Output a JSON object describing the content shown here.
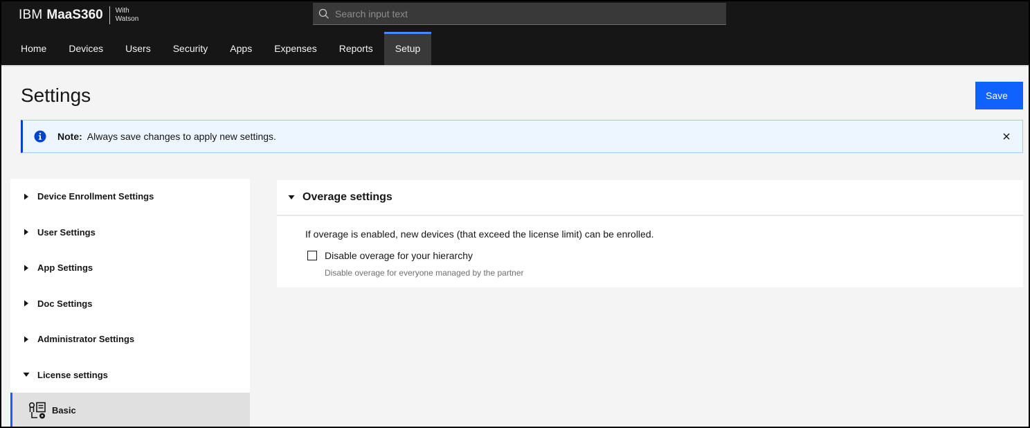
{
  "header": {
    "brand_company": "IBM",
    "brand_product": "MaaS360",
    "brand_with": "With Watson",
    "search_placeholder": "Search input text",
    "nav": [
      {
        "label": "Home"
      },
      {
        "label": "Devices"
      },
      {
        "label": "Users"
      },
      {
        "label": "Security"
      },
      {
        "label": "Apps"
      },
      {
        "label": "Expenses"
      },
      {
        "label": "Reports"
      },
      {
        "label": "Setup",
        "active": true
      }
    ]
  },
  "page": {
    "title": "Settings",
    "save_label": "Save"
  },
  "notification": {
    "title": "Note:",
    "text": "Always save changes to apply new settings."
  },
  "sidebar": {
    "items": [
      {
        "label": "Device Enrollment Settings",
        "expanded": false
      },
      {
        "label": "User Settings",
        "expanded": false
      },
      {
        "label": "App Settings",
        "expanded": false
      },
      {
        "label": "Doc Settings",
        "expanded": false
      },
      {
        "label": "Administrator Settings",
        "expanded": false
      },
      {
        "label": "License settings",
        "expanded": true
      }
    ],
    "sub_item": {
      "label": "Basic",
      "selected": true
    }
  },
  "section": {
    "title": "Overage settings",
    "description": "If overage is enabled, new devices (that exceed the license limit) can be enrolled.",
    "checkbox_label": "Disable overage for your hierarchy",
    "checkbox_checked": false,
    "helper_text": "Disable overage for everyone managed by the partner"
  },
  "colors": {
    "header_bg": "#161616",
    "accent": "#0f62fe",
    "nav_active_bar": "#4589ff",
    "info_bg": "#edf5ff",
    "info_icon": "#0043ce"
  }
}
